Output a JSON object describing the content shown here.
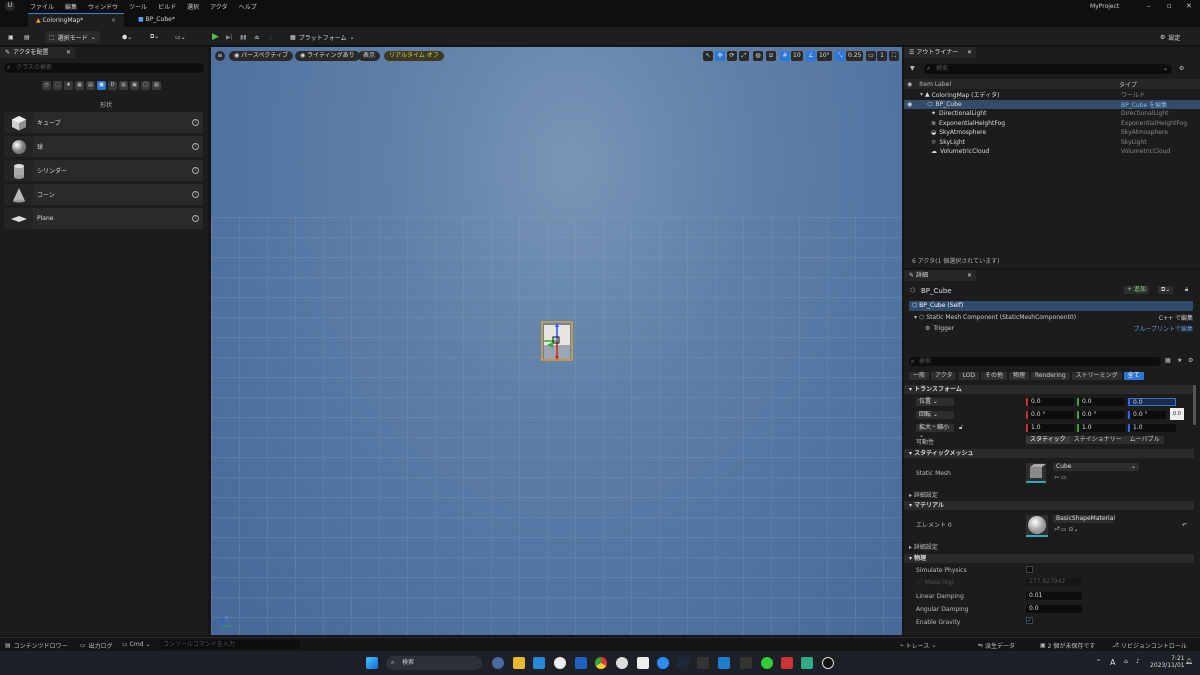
{
  "menubar": {
    "items": [
      "ファイル",
      "編集",
      "ウィンドウ",
      "ツール",
      "ビルド",
      "選択",
      "アクタ",
      "ヘルプ"
    ],
    "project": "MyProject"
  },
  "doc_tabs": [
    "ColoringMap*",
    "BP_Cube*"
  ],
  "toolbar": {
    "mode": "選択モード",
    "platform": "プラットフォーム",
    "settings": "設定"
  },
  "place_actors": {
    "tab": "アクタを配置",
    "search_placeholder": "クラスの検索",
    "category_label": "形状",
    "shapes": [
      "キューブ",
      "球",
      "シリンダー",
      "コーン",
      "Plane"
    ]
  },
  "viewport": {
    "perspective": "パースペクティブ",
    "lighting": "ライティングあり",
    "show": "表示",
    "realtime": "リアルタイム オフ",
    "grid_snap": "10",
    "rot_snap": "10°",
    "scale_snap": "0.25",
    "camera_speed": "1"
  },
  "outliner": {
    "tab": "アウトライナー",
    "search_placeholder": "検索",
    "col_label": "Item Label",
    "col_type": "タイプ",
    "rows": [
      {
        "label": "ColoringMap (エディタ)",
        "type": "ワールド"
      },
      {
        "label": "BP_Cube",
        "type": "BP_Cube を編集"
      },
      {
        "label": "DirectionalLight",
        "type": "DirectionalLight"
      },
      {
        "label": "ExponentialHeightFog",
        "type": "ExponentialHeightFog"
      },
      {
        "label": "SkyAtmosphere",
        "type": "SkyAtmosphere"
      },
      {
        "label": "SkyLight",
        "type": "SkyLight"
      },
      {
        "label": "VolumetricCloud",
        "type": "VolumetricCloud"
      }
    ],
    "count": "6 アクタ(1 個選択されています)"
  },
  "details": {
    "tab": "詳細",
    "actor_name": "BP_Cube",
    "add": "+ 追加",
    "self": "BP_Cube (Self)",
    "component": "Static Mesh Component (StaticMeshComponent0)",
    "component_link": "C++ で編集",
    "trigger": "Trigger",
    "trigger_link": "ブループリントで編集",
    "search_placeholder": "検索",
    "filters": [
      "一般",
      "アクタ",
      "LOD",
      "その他",
      "物理",
      "Rendering",
      "ストリーミング",
      "全て"
    ],
    "transform": {
      "section": "トランスフォーム",
      "location_label": "位置",
      "rotation_label": "回転",
      "scale_label": "拡大・縮小",
      "location": [
        "0.0",
        "0.0",
        "0.0"
      ],
      "rotation": [
        "0.0 °",
        "0.0 °",
        "0.0 °"
      ],
      "scale": [
        "1.0",
        "1.0",
        "1.0"
      ],
      "tooltip": "0.0",
      "mobility_label": "可動性",
      "mobility": [
        "スタティック",
        "ステイショナリー",
        "ムーバブル"
      ]
    },
    "static_mesh": {
      "section": "スタティックメッシュ",
      "label": "Static Mesh",
      "value": "Cube"
    },
    "advanced": "詳細設定",
    "material": {
      "section": "マテリアル",
      "label": "エレメント 0",
      "value": "BasicShapeMaterial"
    },
    "advanced2": "詳細設定",
    "physics": {
      "section": "物理",
      "simulate": "Simulate Physics",
      "mass": "Mass (kg)",
      "mass_value": "177.827942",
      "linear": "Linear Damping",
      "linear_value": "0.01",
      "angular": "Angular Damping",
      "angular_value": "0.0",
      "gravity": "Enable Gravity"
    }
  },
  "bottombar": {
    "content_drawer": "コンテンツドロワー",
    "output_log": "出力ログ",
    "cmd": "Cmd",
    "console_placeholder": "コンソールコマンドを入力",
    "trace": "トレース",
    "derived_data": "派生データ",
    "unsaved": "2 個が未保存です",
    "revision": "リビジョンコントロール"
  },
  "taskbar": {
    "search": "検索",
    "time": "7:21",
    "date": "2023/11/01",
    "ime": "A"
  }
}
